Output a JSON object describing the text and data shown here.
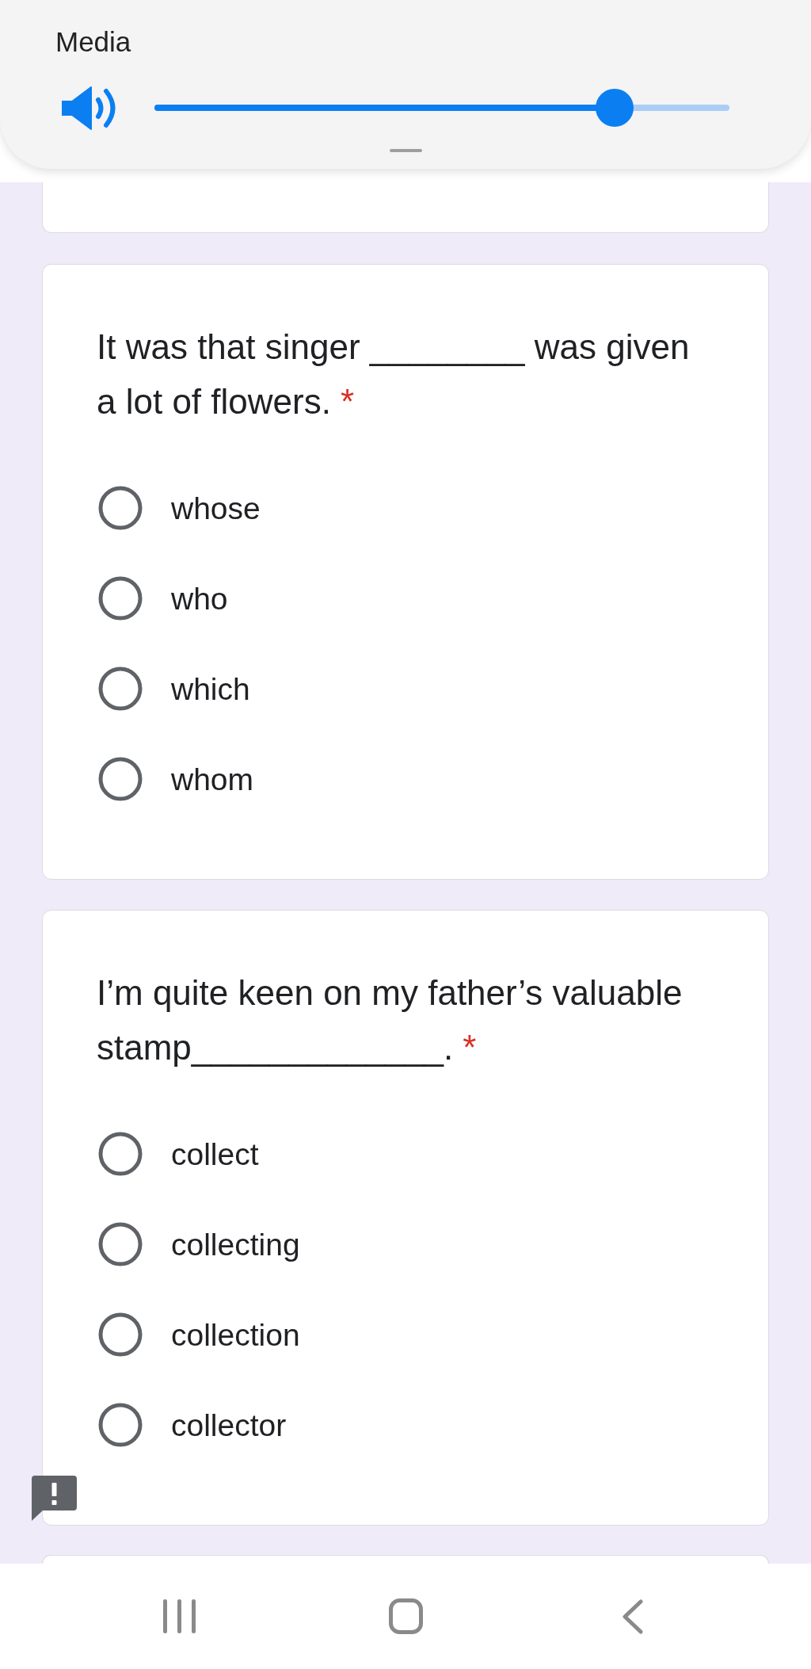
{
  "volume_panel": {
    "title": "Media",
    "level": 0.8
  },
  "questions": [
    {
      "text": "It was that singer ________ was given a lot of flowers.",
      "required_mark": "*",
      "options": [
        {
          "label": "whose",
          "selected": false
        },
        {
          "label": "who",
          "selected": false
        },
        {
          "label": "which",
          "selected": false
        },
        {
          "label": "whom",
          "selected": false
        }
      ]
    },
    {
      "text": "I’m quite keen on my father’s valuable stamp_____________.",
      "required_mark": "*",
      "options": [
        {
          "label": "collect",
          "selected": false
        },
        {
          "label": "collecting",
          "selected": false
        },
        {
          "label": "collection",
          "selected": false
        },
        {
          "label": "collector",
          "selected": false
        }
      ]
    }
  ]
}
